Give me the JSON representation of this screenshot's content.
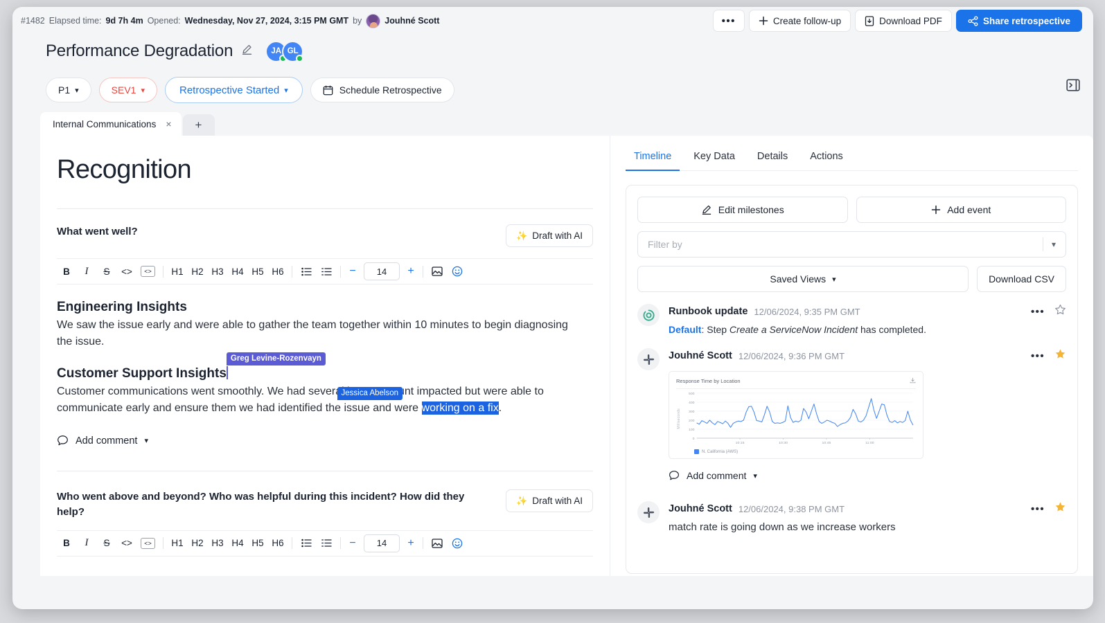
{
  "meta": {
    "incident_id": "#1482",
    "elapsed_label": "Elapsed time:",
    "elapsed_value": "9d 7h 4m",
    "opened_label": "Opened:",
    "opened_value": "Wednesday, Nov 27, 2024, 3:15 PM GMT",
    "by_label": "by",
    "author": "Jouhné Scott"
  },
  "topbar": {
    "more_label": "•••",
    "create_followup": "Create follow-up",
    "download_pdf": "Download PDF",
    "share_retrospective": "Share retrospective",
    "accent": "#1a73e8"
  },
  "title_row": {
    "title": "Performance Degradation",
    "avatars": [
      {
        "initials": "JA",
        "status": "online"
      },
      {
        "initials": "GL",
        "status": "online"
      }
    ]
  },
  "status_row": {
    "priority": "P1",
    "severity": "SEV1",
    "severity_color": "#e8453c",
    "retrospective_status": "Retrospective Started",
    "retrospective_color": "#1a73e8",
    "schedule_button": "Schedule Retrospective"
  },
  "doc_tabs": {
    "tabs": [
      {
        "label": "Internal Communications",
        "close": "×",
        "active": true
      }
    ],
    "add_label": "+"
  },
  "document": {
    "heading": "Recognition",
    "sections": [
      {
        "question": "What went well?",
        "ai_button": "Draft with AI",
        "font_size": "14",
        "blocks": [
          {
            "type": "h3",
            "text": "Engineering Insights"
          },
          {
            "type": "p",
            "text": "We saw the issue early and were able to gather the team together within 10 minutes to begin diagnosing the issue."
          },
          {
            "type": "h3",
            "text": "Customer Support Insights"
          },
          {
            "type": "p_split",
            "before": "Customer communications went smoothly. We had several large account impacted but were able to communicate early and ensure them we had identified the issue and were ",
            "selected": "working on a fix",
            "after": "."
          }
        ],
        "add_comment": "Add comment"
      },
      {
        "question": "Who went above and beyond? Who was helpful during this incident? How did they help?",
        "ai_button": "Draft with AI",
        "font_size": "14",
        "blocks": [],
        "add_comment": "Add comment"
      }
    ],
    "collaborators": [
      {
        "name": "Greg Levine-Rozenvayn",
        "color": "#5b5bd6"
      },
      {
        "name": "Jessica Abelson",
        "color": "#1b63e0"
      }
    ],
    "toolbar": {
      "bold": "B",
      "italic": "I",
      "strike": "S",
      "code": "<>",
      "code_block": "[ ]",
      "headings": [
        "H1",
        "H2",
        "H3",
        "H4",
        "H5",
        "H6"
      ],
      "minus": "−",
      "plus": "+"
    }
  },
  "timeline": {
    "tabs": [
      {
        "label": "Timeline",
        "active": true
      },
      {
        "label": "Key Data",
        "active": false
      },
      {
        "label": "Details",
        "active": false
      },
      {
        "label": "Actions",
        "active": false
      }
    ],
    "edit_milestones": "Edit milestones",
    "add_event": "Add event",
    "filter_placeholder": "Filter by",
    "saved_views": "Saved Views",
    "download_csv": "Download CSV",
    "events": [
      {
        "icon": "runbook-icon",
        "name": "Runbook update",
        "time": "12/06/2024, 9:35 PM GMT",
        "text_prefix": "Default",
        "text_mid": ": Step ",
        "text_em": "Create a ServiceNow Incident",
        "text_suffix": " has completed.",
        "starred": false
      },
      {
        "icon": "slack-icon",
        "name": "Jouhné Scott",
        "time": "12/06/2024, 9:36 PM GMT",
        "starred": true,
        "add_comment": "Add comment"
      },
      {
        "icon": "slack-icon",
        "name": "Jouhné Scott",
        "time": "12/06/2024, 9:38 PM GMT",
        "text_plain": "match rate is going down as we increase workers",
        "starred": true
      }
    ]
  },
  "chart_data": {
    "type": "line",
    "title": "Response Time by Location",
    "xlabel": "",
    "ylabel": "Milliseconds",
    "ylim": [
      0,
      500
    ],
    "yticks": [
      0,
      100,
      200,
      300,
      400,
      500
    ],
    "xticks": [
      "10:15",
      "10:30",
      "10:45",
      "11:00"
    ],
    "legend": [
      "N. California (AWS)"
    ],
    "legend_position": "bottom-left",
    "grid": true,
    "series": [
      {
        "name": "N. California (AWS)",
        "color": "#4285f4",
        "values": [
          170,
          155,
          195,
          180,
          165,
          200,
          170,
          150,
          185,
          175,
          160,
          190,
          165,
          120,
          165,
          180,
          190,
          185,
          200,
          290,
          350,
          355,
          290,
          195,
          190,
          180,
          260,
          355,
          290,
          185,
          165,
          170,
          165,
          175,
          190,
          360,
          230,
          175,
          190,
          180,
          200,
          330,
          290,
          215,
          300,
          380,
          270,
          185,
          165,
          180,
          200,
          190,
          175,
          165,
          130,
          150,
          165,
          170,
          190,
          230,
          320,
          270,
          190,
          180,
          200,
          250,
          345,
          440,
          310,
          220,
          300,
          380,
          370,
          255,
          185,
          175,
          195,
          170,
          185,
          175,
          195,
          300,
          200,
          145
        ]
      }
    ]
  }
}
